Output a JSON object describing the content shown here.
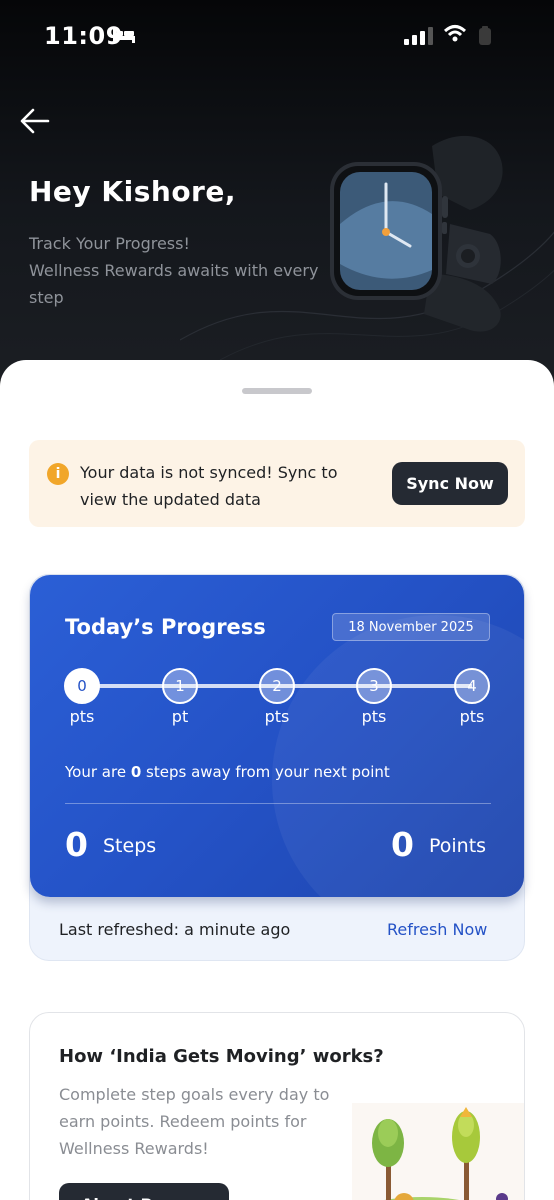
{
  "status_bar": {
    "time": "11:09"
  },
  "header": {
    "greeting": "Hey Kishore,",
    "subtitle_lines": [
      "Track Your Progress!",
      "Wellness Rewards awaits with every",
      "step"
    ]
  },
  "sync_banner": {
    "message": "Your data is not synced! Sync to view the updated data",
    "button_label": "Sync Now",
    "icon": "info-icon",
    "accent_color": "#f1a62a"
  },
  "progress_card": {
    "title": "Today’s Progress",
    "date": "18 November 2025",
    "milestones": [
      {
        "value": "0",
        "unit": "pts"
      },
      {
        "value": "1",
        "unit": "pt"
      },
      {
        "value": "2",
        "unit": "pts"
      },
      {
        "value": "3",
        "unit": "pts"
      },
      {
        "value": "4",
        "unit": "pts"
      }
    ],
    "note_prefix": "Your are ",
    "note_steps": "0",
    "note_suffix": " steps away from your next point",
    "steps_value": "0",
    "steps_label": "Steps",
    "points_value": "0",
    "points_label": "Points",
    "color": "#2452c6"
  },
  "refresh": {
    "label": "Last refreshed: a minute ago",
    "link": "Refresh Now"
  },
  "how_it_works": {
    "title": "How ‘India Gets Moving’ works?",
    "description": "Complete step goals every day to earn points. Redeem points for Wellness Rewards!",
    "button_label": "About Program"
  }
}
